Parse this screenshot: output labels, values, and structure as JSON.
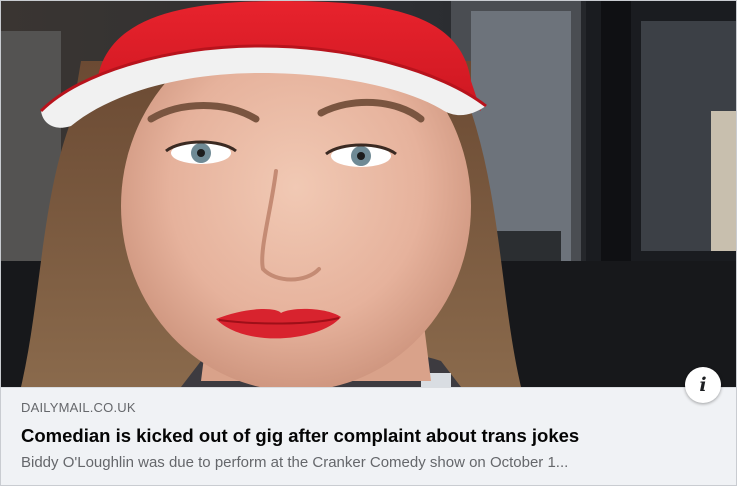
{
  "link_preview": {
    "domain": "DAILYMAIL.CO.UK",
    "headline": "Comedian is kicked out of gig after complaint about trans jokes",
    "description": "Biddy O'Loughlin was due to perform at the Cranker Comedy show on October 1...",
    "info_icon": "info-icon",
    "info_glyph": "i"
  },
  "colors": {
    "caption_background": "#f0f2f5",
    "headline": "#050505",
    "secondary_text": "#65676b",
    "cap_red": "#e0202a",
    "lips": "#d8232e"
  }
}
